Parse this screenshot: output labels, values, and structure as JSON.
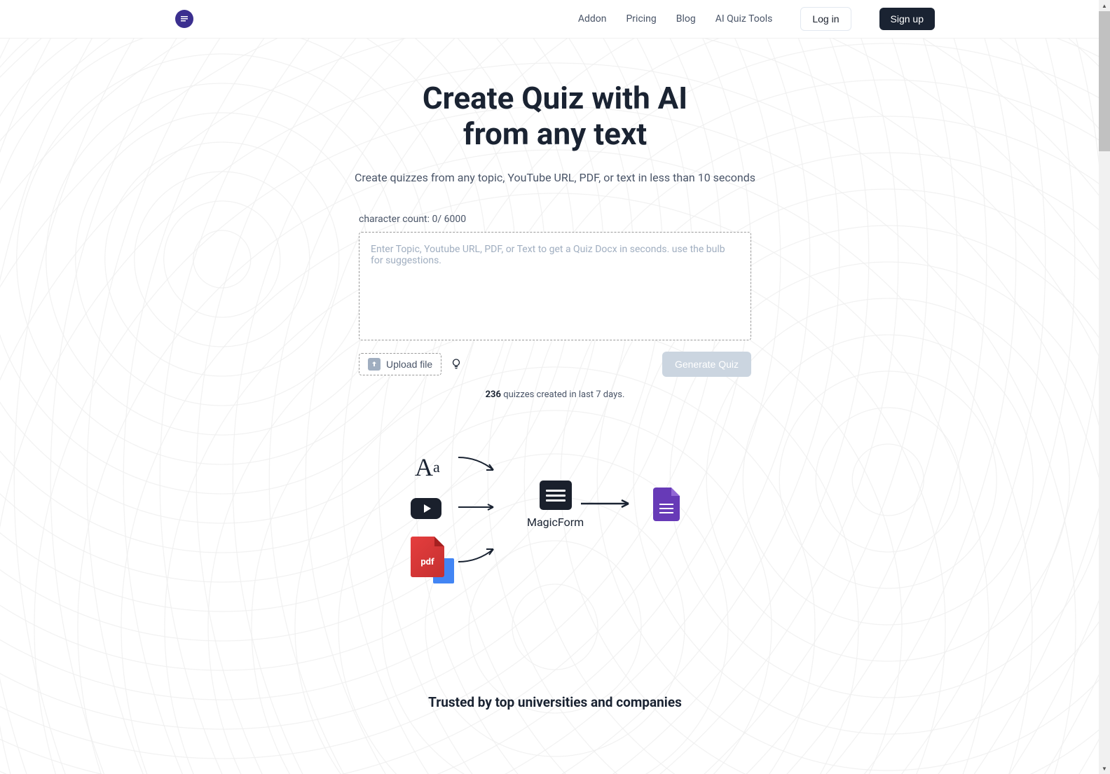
{
  "nav": {
    "links": [
      "Addon",
      "Pricing",
      "Blog",
      "AI Quiz Tools"
    ],
    "login": "Log in",
    "signup": "Sign up"
  },
  "hero": {
    "title_line1": "Create Quiz with AI",
    "title_line2": "from any text",
    "subtitle": "Create quizzes from any topic, YouTube URL, PDF, or text in less than 10 seconds"
  },
  "form": {
    "char_count_label": "character count: 0/ 6000",
    "placeholder": "Enter Topic, Youtube URL, PDF, or Text to get a Quiz Docx in seconds. use the bulb for suggestions.",
    "upload_label": "Upload file",
    "generate_label": "Generate Quiz"
  },
  "stats": {
    "count": "236",
    "text": " quizzes created in last 7 days."
  },
  "diagram": {
    "aa": "A",
    "aa_small": "a",
    "pdf_label": "pdf",
    "magicform_label": "MagicForm"
  },
  "trusted": "Trusted by top universities and companies"
}
